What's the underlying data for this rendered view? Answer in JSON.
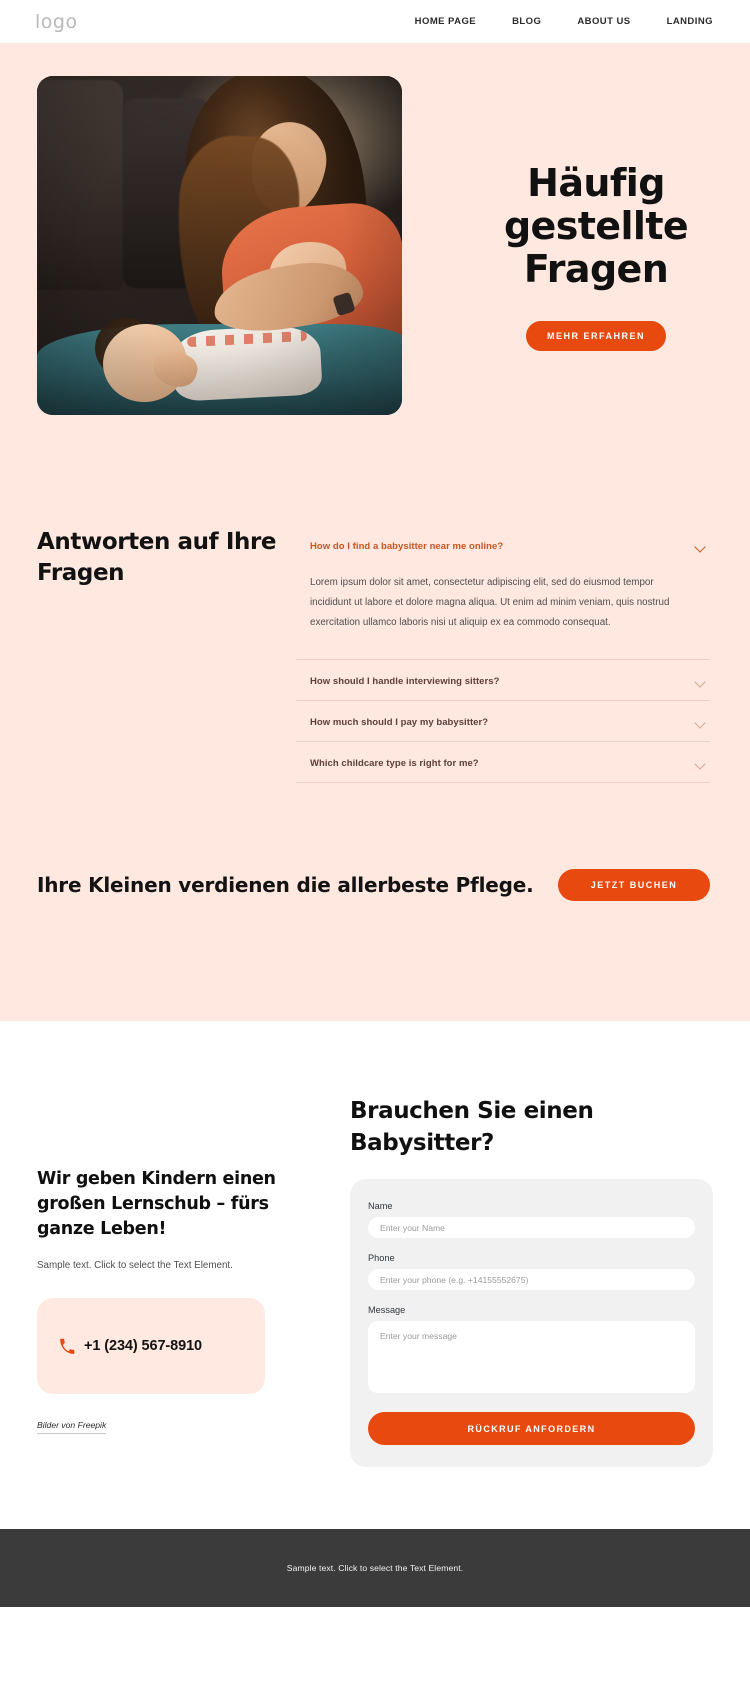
{
  "header": {
    "logo": "logo",
    "nav": [
      {
        "label": "HOME PAGE"
      },
      {
        "label": "BLOG"
      },
      {
        "label": "ABOUT US"
      },
      {
        "label": "LANDING"
      }
    ]
  },
  "hero": {
    "title": "Häufig gestellte Fragen",
    "cta_label": "MEHR ERFAHREN",
    "image_alt": "mother playing with baby in car"
  },
  "faq": {
    "heading": "Antworten auf Ihre Fragen",
    "items": [
      {
        "question": "How do I find a babysitter near me online?",
        "answer": "Lorem ipsum dolor sit amet, consectetur adipiscing elit, sed do eiusmod tempor incididunt ut labore et dolore magna aliqua. Ut enim ad minim veniam, quis nostrud exercitation ullamco laboris nisi ut aliquip ex ea commodo consequat.",
        "open": true
      },
      {
        "question": "How should I handle interviewing sitters?",
        "answer": "",
        "open": false
      },
      {
        "question": "How much should I pay my babysitter?",
        "answer": "",
        "open": false
      },
      {
        "question": "Which childcare type is right for me?",
        "answer": "",
        "open": false
      }
    ]
  },
  "cta": {
    "title": "Ihre Kleinen verdienen die allerbeste Pflege.",
    "button_label": "JETZT BUCHEN"
  },
  "contact": {
    "heading": "Wir geben Kindern einen großen Lernschub – fürs ganze Leben!",
    "subtext": "Sample text. Click to select the Text Element.",
    "phone": "+1 (234) 567-8910",
    "credit": "Bilder von Freepik"
  },
  "form": {
    "title": "Brauchen Sie einen Babysitter?",
    "name_label": "Name",
    "name_placeholder": "Enter your Name",
    "name_value": "",
    "phone_label": "Phone",
    "phone_placeholder": "Enter your phone (e.g. +14155552675)",
    "phone_value": "",
    "message_label": "Message",
    "message_placeholder": "Enter your message",
    "message_value": "",
    "submit_label": "RÜCKRUF ANFORDERN"
  },
  "footer": {
    "text": "Sample text. Click to select the Text Element."
  },
  "colors": {
    "accent": "#e8490f",
    "peach": "#ffe8e0",
    "peach_card": "#ffe9e1",
    "question": "#5e4038",
    "question_active": "#c8561f",
    "footer_bg": "#3b3b3b"
  }
}
